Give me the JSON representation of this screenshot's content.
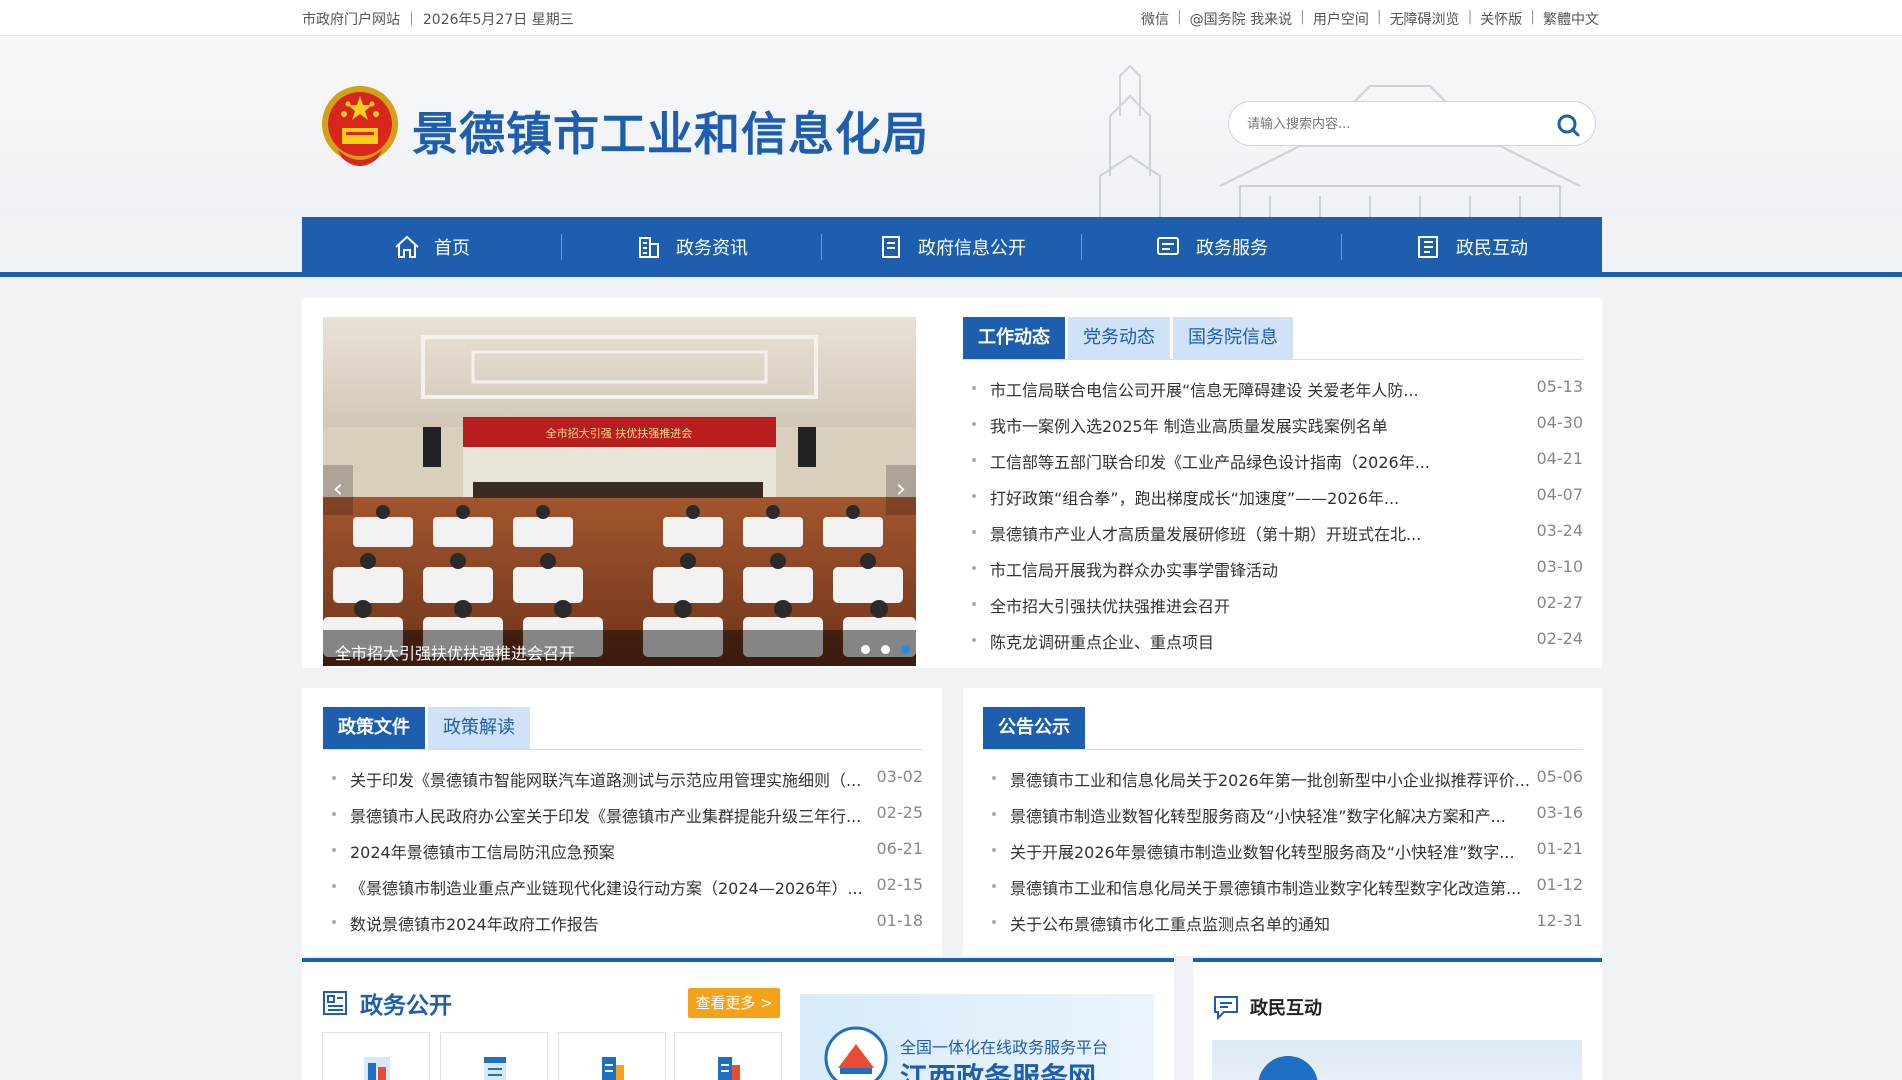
{
  "topbar": {
    "left": "市政府门户网站 ｜ 2026年5月27日 星期三",
    "links": [
      "微信",
      "@国务院 我来说",
      "用户空间",
      "无障碍浏览",
      "关怀版",
      "繁體中文"
    ]
  },
  "header": {
    "site_title": "景德镇市工业和信息化局",
    "search_placeholder": "请输入搜索内容..."
  },
  "nav": [
    {
      "label": "首页",
      "icon": "home-icon"
    },
    {
      "label": "政务资讯",
      "icon": "building-icon"
    },
    {
      "label": "政府信息公开",
      "icon": "document-icon"
    },
    {
      "label": "政务服务",
      "icon": "service-icon"
    },
    {
      "label": "政民互动",
      "icon": "interaction-icon"
    }
  ],
  "slider": {
    "caption": "全市招大引强扶优扶强推进会召开",
    "banner_text": "全市招大引强 扶优扶强推进会",
    "prev": "‹",
    "next": "›"
  },
  "news": {
    "tabs": [
      "工作动态",
      "党务动态",
      "国务院信息"
    ],
    "items": [
      {
        "title": "市工信局联合电信公司开展“信息无障碍建设 关爱老年人防...",
        "date": "05-13"
      },
      {
        "title": "我市一案例入选2025年 制造业高质量发展实践案例名单",
        "date": "04-30"
      },
      {
        "title": "工信部等五部门联合印发《工业产品绿色设计指南（2026年...",
        "date": "04-21"
      },
      {
        "title": "打好政策“组合拳”，跑出梯度成长“加速度”——2026年...",
        "date": "04-07"
      },
      {
        "title": "景德镇市产业人才高质量发展研修班（第十期）开班式在北...",
        "date": "03-24"
      },
      {
        "title": "市工信局开展我为群众办实事学雷锋活动",
        "date": "03-10"
      },
      {
        "title": "全市招大引强扶优扶强推进会召开",
        "date": "02-27"
      },
      {
        "title": "陈克龙调研重点企业、重点项目",
        "date": "02-24"
      }
    ]
  },
  "policy": {
    "tabs": [
      "政策文件",
      "政策解读"
    ],
    "items": [
      {
        "title": "关于印发《景德镇市智能网联汽车道路测试与示范应用管理实施细则（...",
        "date": "03-02"
      },
      {
        "title": "景德镇市人民政府办公室关于印发《景德镇市产业集群提能升级三年行...",
        "date": "02-25"
      },
      {
        "title": "2024年景德镇市工信局防汛应急预案",
        "date": "06-21"
      },
      {
        "title": "《景德镇市制造业重点产业链现代化建设行动方案（2024—2026年）...",
        "date": "02-15"
      },
      {
        "title": "数说景德镇市2024年政府工作报告",
        "date": "01-18"
      }
    ]
  },
  "notice": {
    "tabs": [
      "公告公示"
    ],
    "items": [
      {
        "title": "景德镇市工业和信息化局关于2026年第一批创新型中小企业拟推荐评价...",
        "date": "05-06"
      },
      {
        "title": "景德镇市制造业数智化转型服务商及“小快轻准”数字化解决方案和产...",
        "date": "03-16"
      },
      {
        "title": "关于开展2026年景德镇市制造业数智化转型服务商及“小快轻准”数字...",
        "date": "01-21"
      },
      {
        "title": "景德镇市工业和信息化局关于景德镇市制造业数字化转型数字化改造第...",
        "date": "01-12"
      },
      {
        "title": "关于公布景德镇市化工重点监测点名单的通知",
        "date": "12-31"
      }
    ]
  },
  "zwgk": {
    "title": "政务公开",
    "more": "查看更多 >"
  },
  "banner": {
    "line1": "全国一体化在线政务服务平台",
    "line2": "江西政务服务网"
  },
  "zmhd": {
    "title": "政民互动"
  },
  "colors": {
    "primary": "#1d5fae",
    "tab_inactive": "#cfe2f7",
    "more_button": "#f3a21a"
  }
}
